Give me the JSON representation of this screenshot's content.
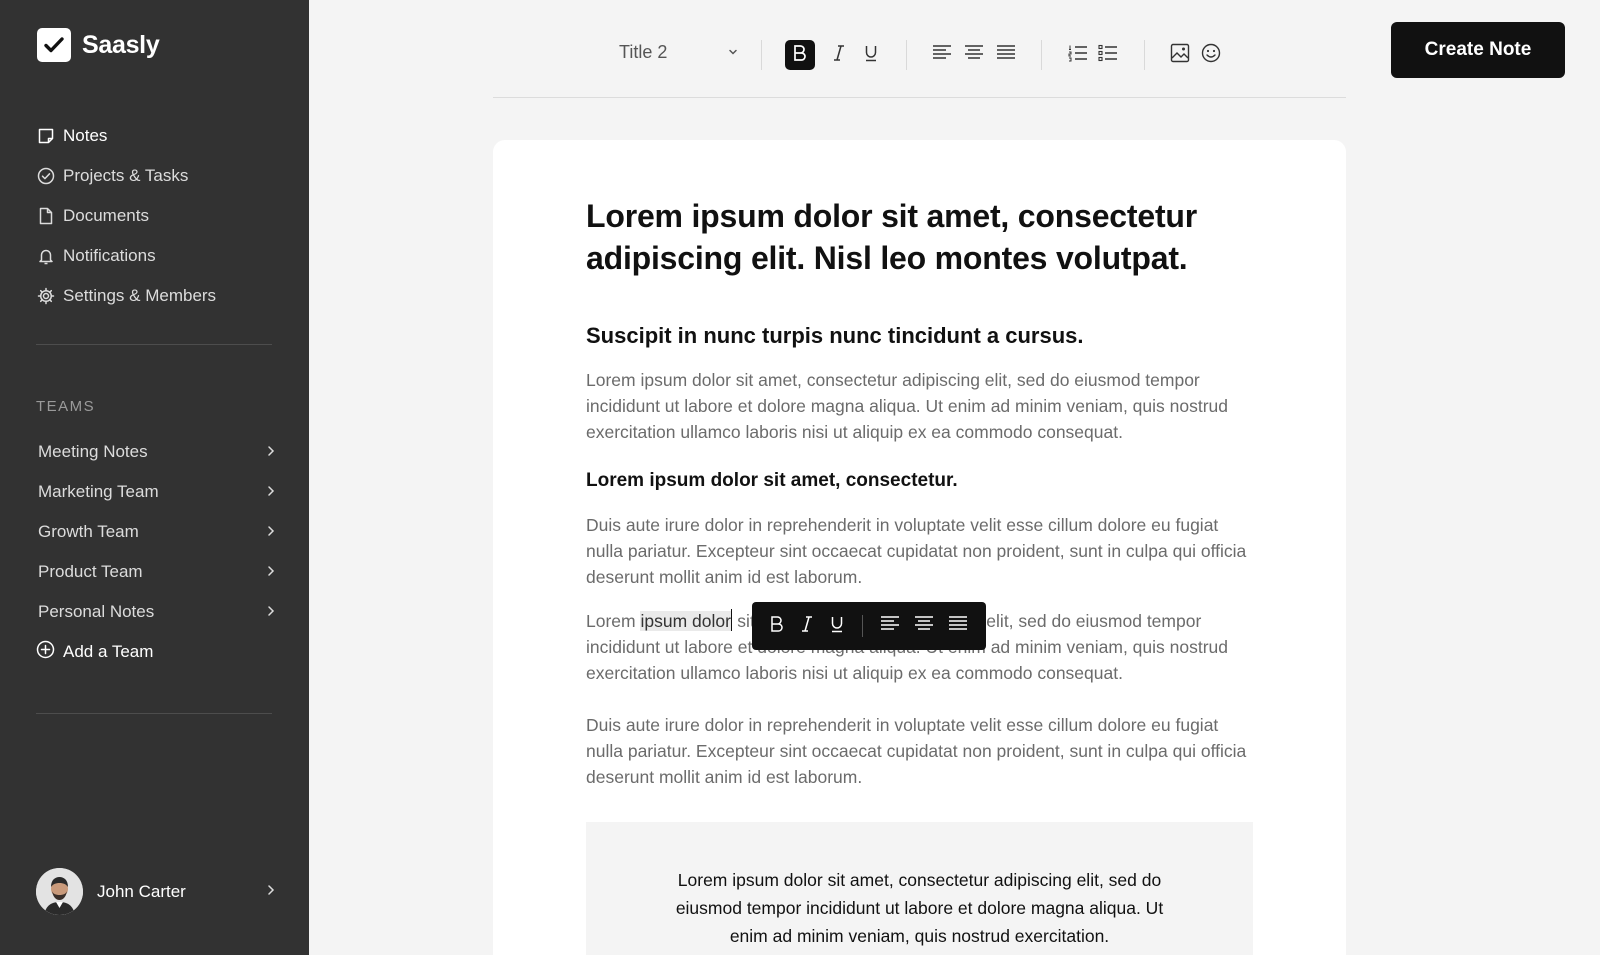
{
  "brand": {
    "name": "Saasly"
  },
  "nav": {
    "items": [
      {
        "label": "Notes",
        "icon": "note-icon",
        "active": true
      },
      {
        "label": "Projects & Tasks",
        "icon": "check-circle-icon"
      },
      {
        "label": "Documents",
        "icon": "document-icon"
      },
      {
        "label": "Notifications",
        "icon": "bell-icon"
      },
      {
        "label": "Settings & Members",
        "icon": "gear-icon"
      }
    ]
  },
  "teams": {
    "title": "TEAMS",
    "items": [
      {
        "label": "Meeting Notes"
      },
      {
        "label": "Marketing Team"
      },
      {
        "label": "Growth Team"
      },
      {
        "label": "Product Team"
      },
      {
        "label": "Personal Notes"
      }
    ],
    "add_label": "Add a Team"
  },
  "user": {
    "name": "John Carter"
  },
  "toolbar": {
    "heading_value": "Title 2",
    "create_label": "Create Note"
  },
  "doc": {
    "title": "Lorem ipsum dolor sit amet, consectetur adipiscing elit. Nisl leo montes volutpat.",
    "h2": "Suscipit in nunc turpis nunc tincidunt a cursus.",
    "p1": "Lorem ipsum dolor sit amet, consectetur adipiscing elit, sed do eiusmod tempor incididunt ut labore et dolore magna aliqua. Ut enim ad minim veniam, quis nostrud exercitation ullamco laboris nisi ut aliquip ex ea commodo consequat.",
    "h3": "Lorem ipsum dolor sit amet, consectetur.",
    "p2": "Duis aute irure dolor in reprehenderit in voluptate velit esse cillum dolore eu fugiat nulla pariatur. Excepteur sint occaecat cupidatat non proident, sunt in culpa qui officia deserunt mollit anim id est laborum.",
    "p3_before": "Lorem ",
    "p3_selected": "ipsum dolor",
    "p3_after": " sit amet, consectetur adipiscing elit, sed do eiusmod tempor incididunt ut labore et dolore magna aliqua. Ut enim ad minim veniam, quis nostrud exercitation ullamco laboris nisi ut aliquip ex ea commodo consequat.",
    "p4": "Duis aute irure dolor in reprehenderit in voluptate velit esse cillum dolore eu fugiat nulla pariatur. Excepteur sint occaecat cupidatat non proident, sunt in culpa qui officia deserunt mollit anim id est laborum.",
    "quote": "Lorem ipsum dolor sit amet, consectetur adipiscing elit, sed do eiusmod tempor incididunt ut labore et dolore magna aliqua. Ut enim ad minim veniam, quis nostrud exercitation."
  }
}
